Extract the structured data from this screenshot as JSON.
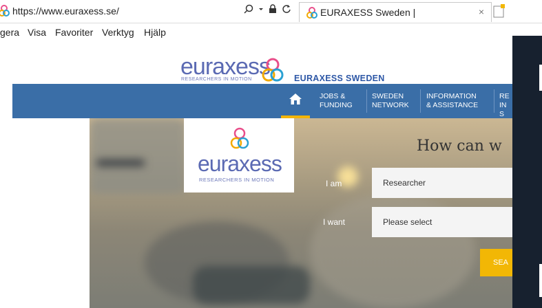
{
  "browser": {
    "url": "https://www.euraxess.se/",
    "tab_title": "EURAXESS Sweden |",
    "tab_close": "×",
    "menu": [
      "gera",
      "Visa",
      "Favoriter",
      "Verktyg",
      "Hjälp"
    ]
  },
  "site": {
    "logo_word": "euraxess",
    "logo_tagline": "RESEARCHERS IN MOTION",
    "site_name": "EURAXESS SWEDEN"
  },
  "nav": {
    "home_icon": "home-icon",
    "items": [
      {
        "line1": "JOBS &",
        "line2": "FUNDING"
      },
      {
        "line1": "SWEDEN",
        "line2": "NETWORK"
      },
      {
        "line1": "INFORMATION",
        "line2": "& ASSISTANCE"
      },
      {
        "line1": "RE",
        "line2": "IN S"
      }
    ]
  },
  "hero": {
    "logo_word": "euraxess",
    "logo_tagline": "RESEARCHERS IN MOTION",
    "heading": "How can w",
    "i_am_label": "I am",
    "i_am_value": "Researcher",
    "i_want_label": "I want",
    "i_want_value": "Please select",
    "search_label": "SEA"
  },
  "colors": {
    "nav_blue": "#3a6ea7",
    "accent_yellow": "#f2b705",
    "logo_blue": "#5b6ab3",
    "overlay_dark": "#17212f"
  }
}
